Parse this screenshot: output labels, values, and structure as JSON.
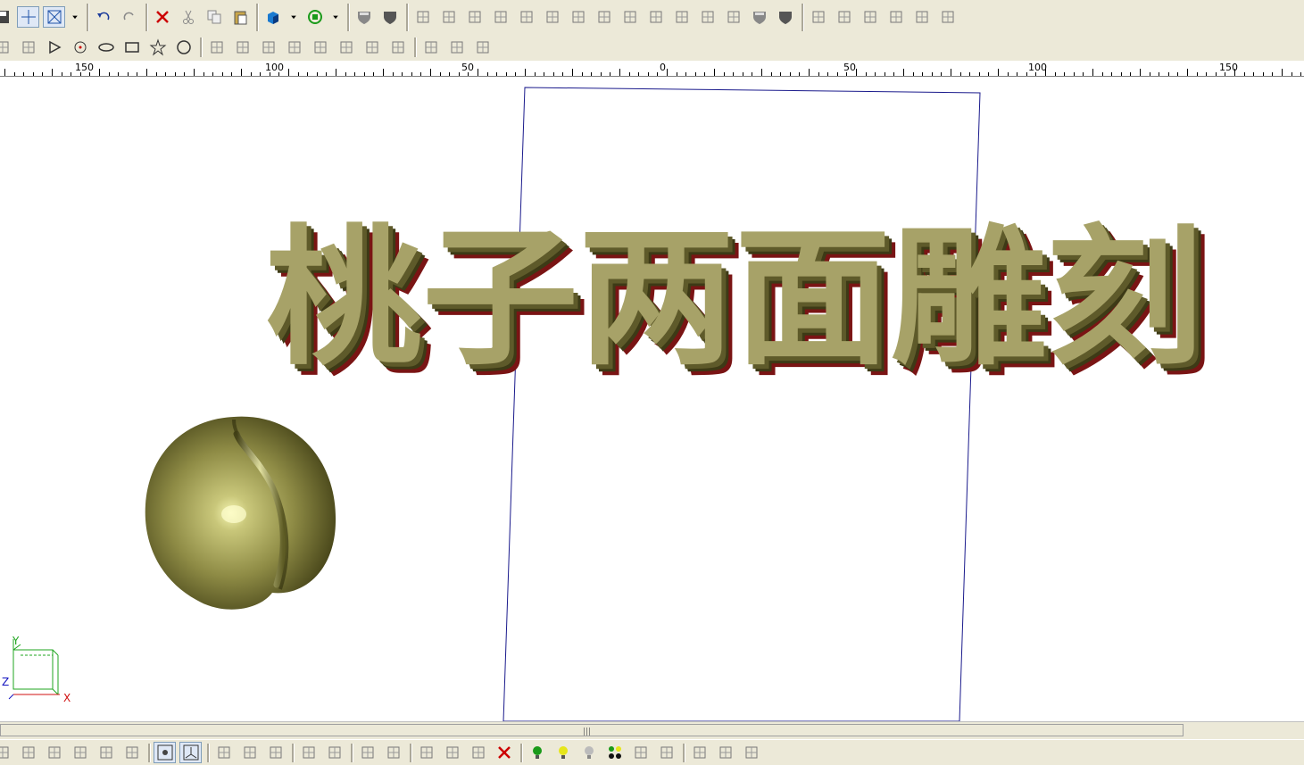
{
  "title_text": "桃子两面雕刻",
  "ruler": {
    "labels": [
      "150",
      "100",
      "50",
      "0",
      "50",
      "100",
      "150"
    ]
  },
  "axis": {
    "x": "X",
    "y": "Y",
    "z": "Z"
  },
  "colors": {
    "toolbar_bg": "#ece9d8",
    "model_olive": "#9a9a5a",
    "text_face": "#a7a268",
    "text_side": "#5e5a2a",
    "text_shadow_edge": "#8b1a1a",
    "frame_line": "#1a1a8c",
    "axis_green": "#1fa51f",
    "axis_red": "#d01010"
  },
  "toolbars": {
    "top_row": [
      "save-icon",
      "cursor-cross-icon",
      "select-box-icon",
      "dropdown-icon",
      "undo-icon",
      "redo-icon",
      "delete-icon",
      "cut-icon",
      "copy-icon",
      "paste-icon",
      "render-cube-icon",
      "dropdown-icon",
      "rotate-view-icon",
      "dropdown-icon",
      "shield-icon",
      "shield-dark-icon",
      "align-icon",
      "distribute-icon",
      "gear-icon",
      "skew-icon",
      "box-icon",
      "grid-icon",
      "curve-icon",
      "node-icon",
      "spiral-icon",
      "snap-grid-icon",
      "snap-cross-icon",
      "group-icon",
      "ungroup-icon",
      "shield-icon",
      "shield-dark-icon",
      "add-point-icon",
      "measure-icon",
      "scale-icon",
      "crop-icon",
      "angle-icon",
      "lasso-icon"
    ],
    "second_row": [
      "arc-icon",
      "bezier-icon",
      "triangle-icon",
      "target-icon",
      "ellipse-icon",
      "rectangle-icon",
      "star-icon",
      "circle-icon",
      "scissors-icon",
      "trim-icon",
      "fillet-icon",
      "chamfer-icon",
      "corner-icon",
      "offset-icon",
      "slot-icon",
      "inset-icon",
      "array-icon",
      "mirror-icon",
      "pattern-icon"
    ],
    "bottom_row": [
      "snap-icon",
      "cross-icon",
      "arc-snap-icon",
      "circle-snap-icon",
      "perpendicular-icon",
      "tangent-icon",
      "grid-point-icon",
      "origin-icon",
      "diamond-icon",
      "diamond2-icon",
      "diamond3-icon",
      "plane-icon",
      "plane2-icon",
      "arrow-x-icon",
      "arrow-x2-icon",
      "transform-icon",
      "transform2-icon",
      "list-icon",
      "delete-icon",
      "light-green-icon",
      "light-yellow-icon",
      "light-gray-icon",
      "lights-icon",
      "arrow-left-icon",
      "arrow-right-icon",
      "book-icon",
      "layers-icon",
      "lamp-icon"
    ]
  }
}
